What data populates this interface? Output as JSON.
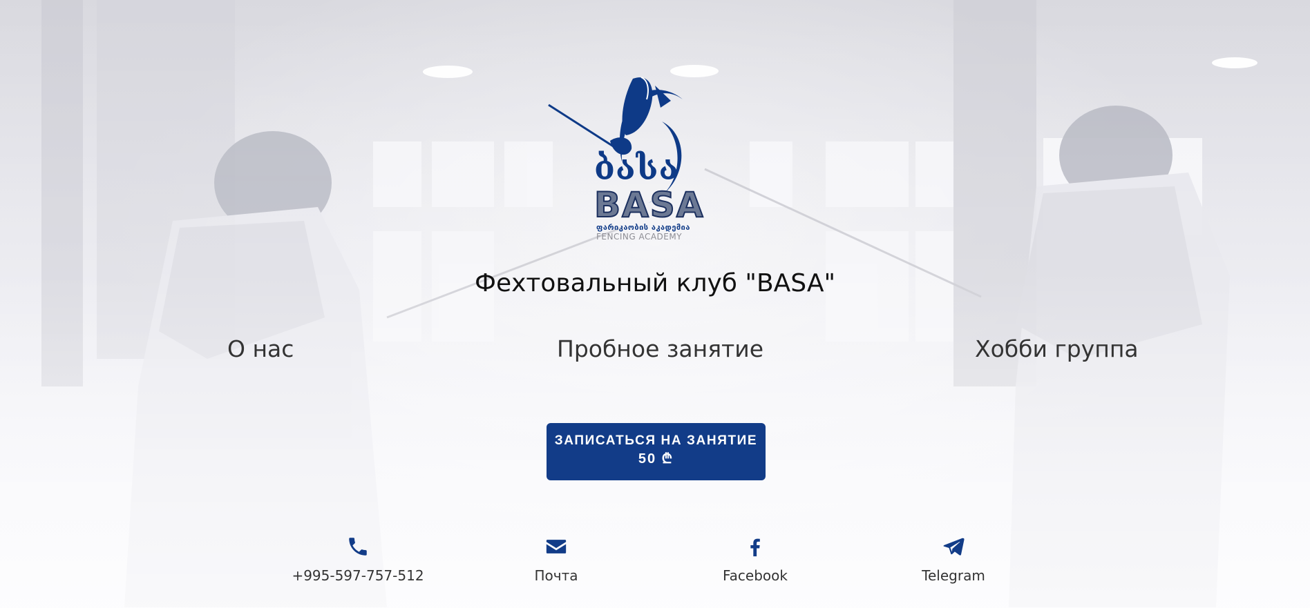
{
  "colors": {
    "brand": "#123c88",
    "text": "#222222",
    "background": "#ececf1"
  },
  "logo": {
    "text_ka": "ბასა",
    "text_en": "BASA",
    "subtitle_ka": "ფარიკაობის აკადემია",
    "subtitle_en": "FENCING ACADEMY"
  },
  "header": {
    "title": "Фехтовальный клуб \"BASA\""
  },
  "nav": {
    "items": [
      {
        "label": "О нас"
      },
      {
        "label": "Пробное занятие"
      },
      {
        "label": "Хобби группа"
      }
    ]
  },
  "cta": {
    "label": "ЗАПИСАТЬСЯ НА ЗАНЯТИЕ",
    "price": "50 ₾"
  },
  "contacts": [
    {
      "icon": "phone-icon",
      "label": "+995-597-757-512"
    },
    {
      "icon": "envelope-icon",
      "label": "Почта"
    },
    {
      "icon": "facebook-icon",
      "label": "Facebook"
    },
    {
      "icon": "telegram-icon",
      "label": "Telegram"
    }
  ]
}
